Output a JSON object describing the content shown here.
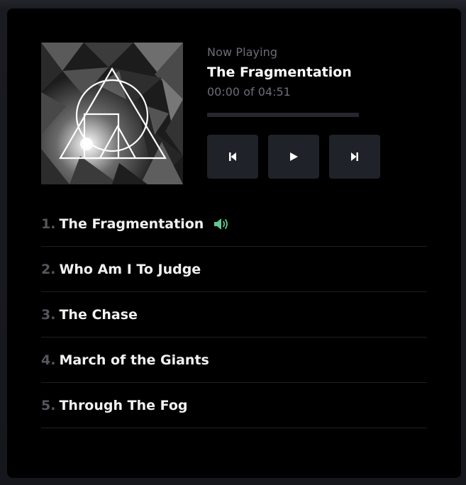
{
  "player": {
    "now_playing_label": "Now Playing",
    "current_track_title": "The Fragmentation",
    "elapsed": "00:00",
    "time_separator": "of",
    "duration": "04:51",
    "progress_fraction": 0,
    "controls": {
      "previous_icon": "skip-previous-icon",
      "play_icon": "play-icon",
      "next_icon": "skip-next-icon"
    },
    "playing_indicator_icon": "speaker-volume-icon",
    "accent_color": "#5fc891"
  },
  "album_art": {
    "icon": "triangle-circle-album-art"
  },
  "tracks": [
    {
      "number": "1.",
      "title": "The Fragmentation",
      "playing": true
    },
    {
      "number": "2.",
      "title": "Who Am I To Judge",
      "playing": false
    },
    {
      "number": "3.",
      "title": "The Chase",
      "playing": false
    },
    {
      "number": "4.",
      "title": "March of the Giants",
      "playing": false
    },
    {
      "number": "5.",
      "title": "Through The Fog",
      "playing": false
    }
  ]
}
